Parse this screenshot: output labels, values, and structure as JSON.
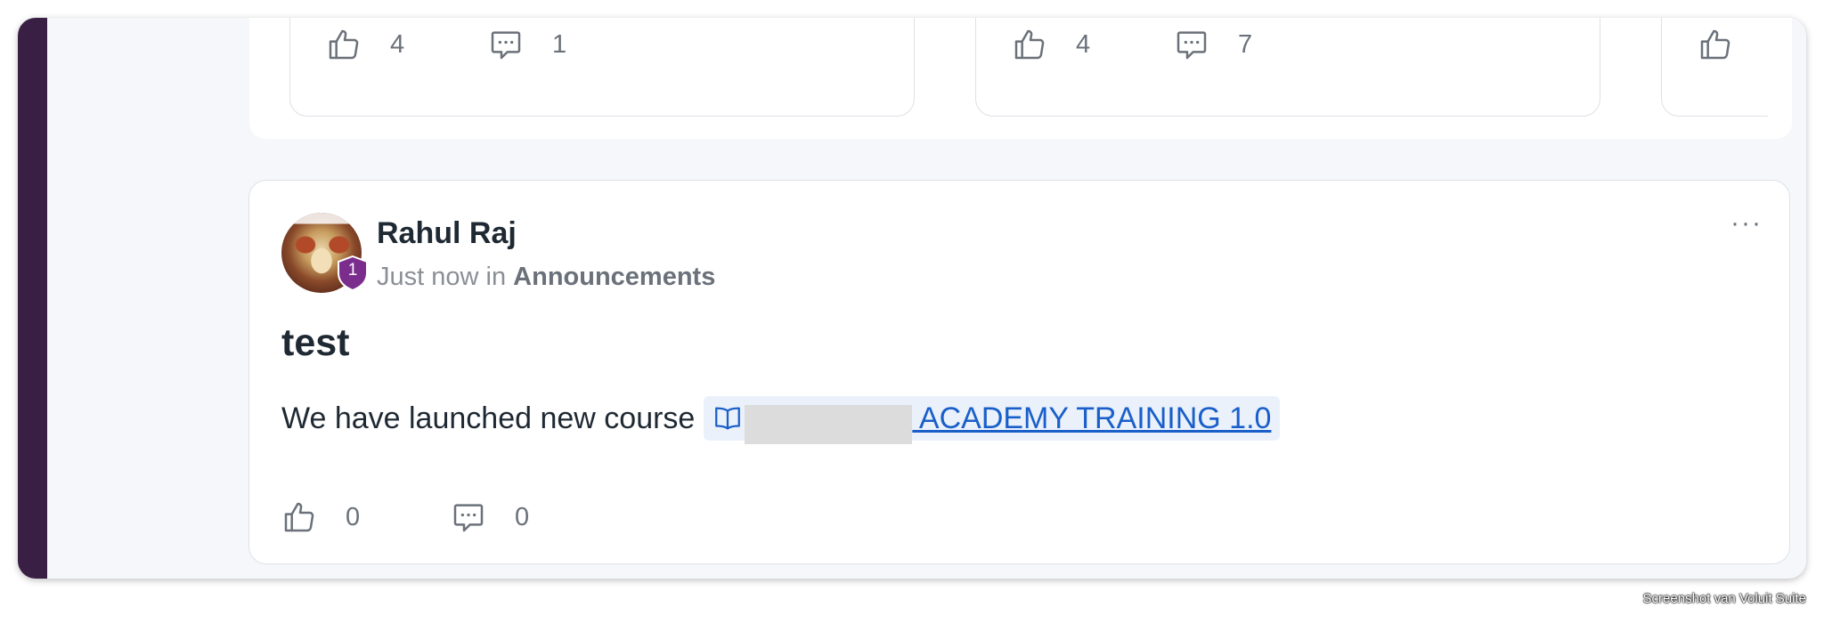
{
  "feed": {
    "previous_cards": [
      {
        "likes": "4",
        "comments": "1"
      },
      {
        "likes": "4",
        "comments": "7"
      },
      {
        "likes": ""
      }
    ]
  },
  "post": {
    "author": "Rahul Raj",
    "badge_level": "1",
    "timestamp": "Just now",
    "in_label": "in",
    "space": "Announcements",
    "more_label": "···",
    "title": "test",
    "body_text": "We have launched new course",
    "course_link_visible": " ACADEMY TRAINING 1.0",
    "likes": "0",
    "comments": "0"
  },
  "colors": {
    "rail": "#3a1f45",
    "badge": "#7b2d8e",
    "link": "#1a5fc9",
    "chip_bg": "#eaf1fb"
  },
  "icons": {
    "like": "thumbs-up-icon",
    "comment": "comment-bubble-icon",
    "course": "open-book-icon",
    "more": "more-horizontal-icon"
  },
  "watermark": "Screenshot van Voluit Suite"
}
